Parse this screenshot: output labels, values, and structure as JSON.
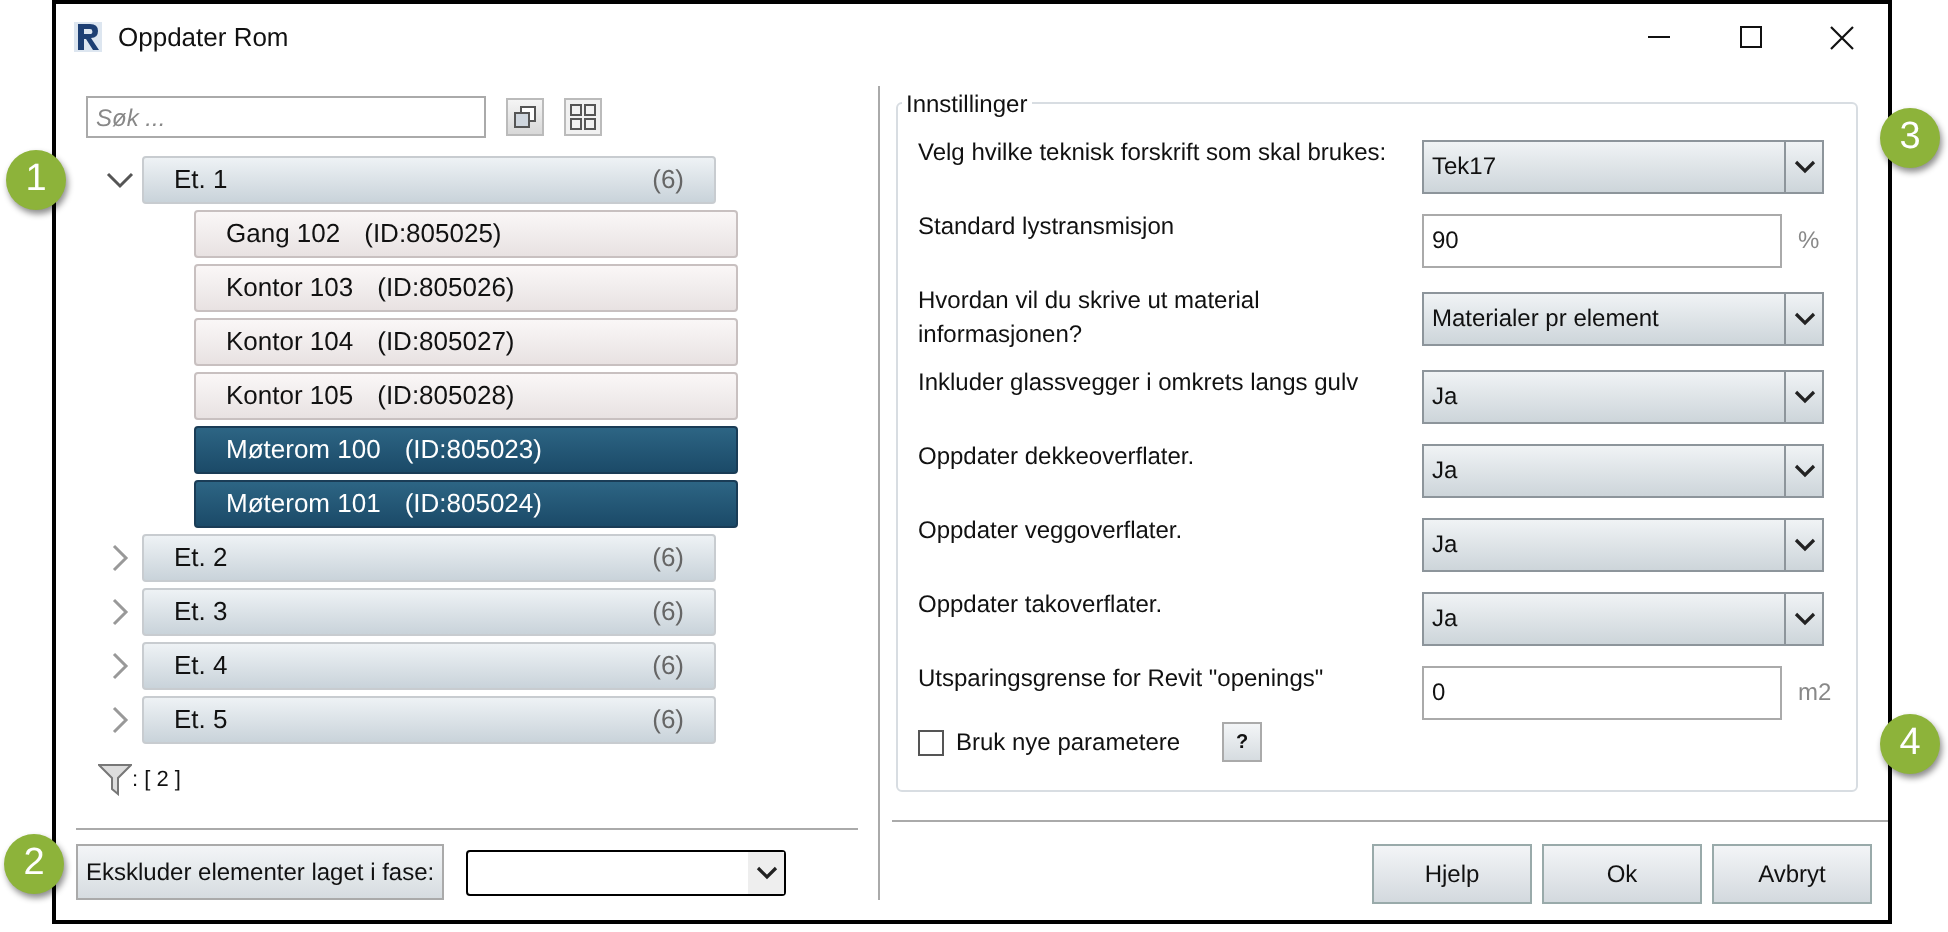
{
  "window": {
    "title": "Oppdater Rom"
  },
  "search": {
    "placeholder": "Søk ..."
  },
  "tree": [
    {
      "label": "Et. 1",
      "count": "(6)",
      "expanded": true,
      "children": [
        {
          "name": "Gang 102",
          "id": "(ID:805025)",
          "selected": false
        },
        {
          "name": "Kontor 103",
          "id": "(ID:805026)",
          "selected": false
        },
        {
          "name": "Kontor 104",
          "id": "(ID:805027)",
          "selected": false
        },
        {
          "name": "Kontor 105",
          "id": "(ID:805028)",
          "selected": false
        },
        {
          "name": "Møterom 100",
          "id": "(ID:805023)",
          "selected": true
        },
        {
          "name": "Møterom 101",
          "id": "(ID:805024)",
          "selected": true
        }
      ]
    },
    {
      "label": "Et. 2",
      "count": "(6)",
      "expanded": false
    },
    {
      "label": "Et. 3",
      "count": "(6)",
      "expanded": false
    },
    {
      "label": "Et. 4",
      "count": "(6)",
      "expanded": false
    },
    {
      "label": "Et. 5",
      "count": "(6)",
      "expanded": false
    }
  ],
  "filter": {
    "count": ": [ 2 ]"
  },
  "exclude": {
    "button": "Ekskluder elementer laget i fase:"
  },
  "settings": {
    "title": "Innstillinger",
    "rows": [
      {
        "kind": "select",
        "label": "Velg hvilke teknisk forskrift som skal brukes:",
        "value": "Tek17"
      },
      {
        "kind": "input",
        "label": "Standard lystransmisjon",
        "value": "90",
        "unit": "%"
      },
      {
        "kind": "select",
        "label": "Hvordan vil du skrive ut material informasjonen?",
        "value": "Materialer pr element"
      },
      {
        "kind": "select",
        "label": "Inkluder glassvegger i omkrets langs gulv",
        "value": "Ja"
      },
      {
        "kind": "select",
        "label": "Oppdater dekkeoverflater.",
        "value": "Ja"
      },
      {
        "kind": "select",
        "label": "Oppdater veggoverflater.",
        "value": "Ja"
      },
      {
        "kind": "select",
        "label": "Oppdater takoverflater.",
        "value": "Ja"
      },
      {
        "kind": "input",
        "label": "Utsparingsgrense for Revit \"openings\"",
        "value": "0",
        "unit": "m2"
      }
    ],
    "checkbox": {
      "label": "Bruk nye parametere",
      "checked": false
    },
    "help": "?"
  },
  "buttons": [
    "Hjelp",
    "Ok",
    "Avbryt"
  ],
  "callouts": [
    "1",
    "2",
    "3",
    "4"
  ]
}
